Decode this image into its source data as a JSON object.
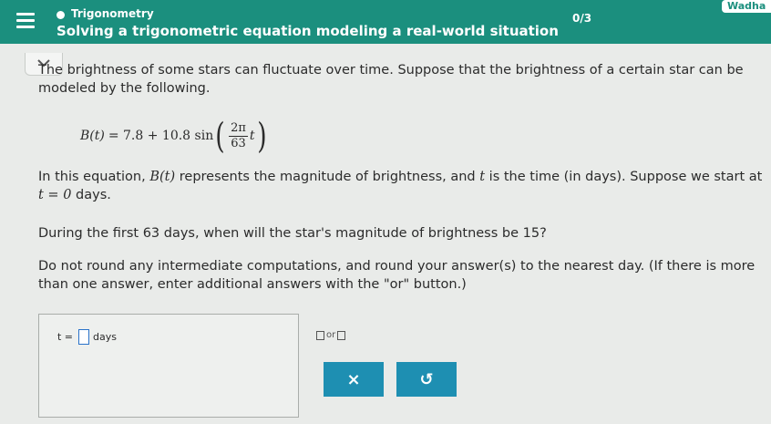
{
  "header": {
    "topic": "Trigonometry",
    "title": "Solving a trigonometric equation modeling a real-world situation",
    "progress": "0/3",
    "user": "Wadha"
  },
  "problem": {
    "intro": "The brightness of some stars can fluctuate over time. Suppose that the brightness of a certain star can be modeled by the following.",
    "formula": {
      "lhs": "B(t)",
      "eq": "= 7.8 + 10.8 sin",
      "num": "2π",
      "den": "63",
      "var": "t"
    },
    "para2_a": "In this equation, ",
    "para2_b": "B(t)",
    "para2_c": " represents the magnitude of brightness, and ",
    "para2_d": "t",
    "para2_e": " is the time (in days). Suppose we start at ",
    "para2_f": "t = 0",
    "para2_g": " days.",
    "question": "During the first 63 days, when will the star's magnitude of brightness be 15?",
    "instructions": "Do not round any intermediate computations, and round your answer(s) to the nearest day. (If there is more than one answer, enter additional answers with the \"or\" button.)"
  },
  "answer": {
    "var_label": "t =",
    "value": "",
    "unit": "days",
    "or_label": "or"
  },
  "buttons": {
    "clear": "×",
    "undo": "↺"
  }
}
